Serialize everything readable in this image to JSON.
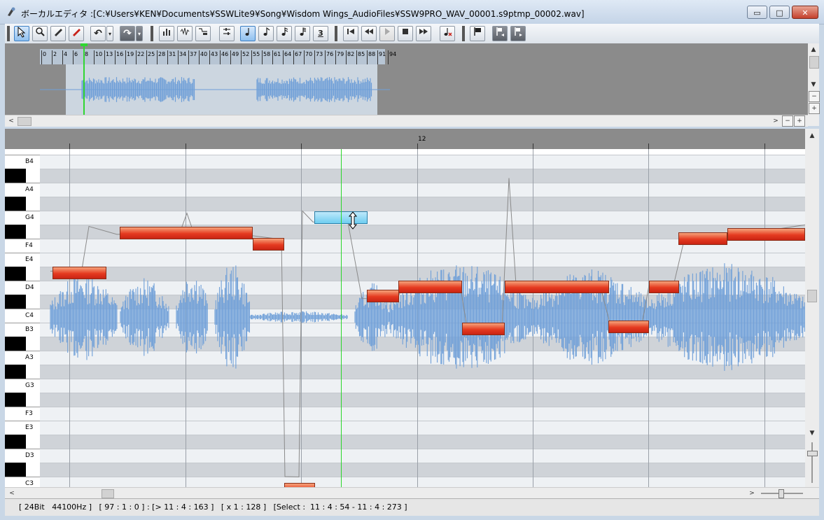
{
  "window": {
    "title": "ボーカルエディタ :[C:¥Users¥KEN¥Documents¥SSWLite9¥Song¥Wisdom Wings_AudioFiles¥SSW9PRO_WAV_00001.s9ptmp_00002.wav]",
    "minimize": "▭",
    "maximize": "□",
    "close": "✕"
  },
  "toolbar": {
    "undo_glyph": "↶",
    "redo_glyph": "↷",
    "quantize_3": "3",
    "dropdown": "▾"
  },
  "overview": {
    "ruler_labels": [
      "0",
      "2",
      "4",
      "6",
      "8",
      "10",
      "13",
      "16",
      "19",
      "22",
      "25",
      "28",
      "31",
      "34",
      "37",
      "40",
      "43",
      "46",
      "49",
      "52",
      "55",
      "58",
      "61",
      "64",
      "67",
      "70",
      "73",
      "76",
      "79",
      "82",
      "85",
      "88",
      "91",
      "94"
    ],
    "minus": "−",
    "plus": "+",
    "arrow_up": "▲",
    "arrow_down": "▼",
    "arrow_left": "<",
    "arrow_right": ">"
  },
  "main": {
    "ruler_label": "12",
    "keys": [
      {
        "label": "B4"
      },
      {
        "label": "A4"
      },
      {
        "label": "G4"
      },
      {
        "label": "F4"
      },
      {
        "label": "E4"
      },
      {
        "label": "D4"
      },
      {
        "label": "C4"
      },
      {
        "label": "B3"
      },
      {
        "label": "A3"
      },
      {
        "label": "G3"
      },
      {
        "label": "F3"
      },
      {
        "label": "E3"
      },
      {
        "label": "D3"
      },
      {
        "label": "C3"
      }
    ],
    "arrow_up": "▲",
    "arrow_down": "▼",
    "arrow_left": "<",
    "arrow_right": ">"
  },
  "status": {
    "text": "[ 24Bit   44100Hz ]   [ 97 : 1 : 0 ] : [> 11 : 4 : 163 ]   [ x 1 : 128 ]   [Select :  11 : 4 : 54 - 11 : 4 : 273 ]"
  },
  "colors": {
    "note_fill": "#e53a20",
    "note_selected": "#6fcdf0",
    "waveform": "#6f9fd8",
    "playhead": "#2bd62b"
  }
}
